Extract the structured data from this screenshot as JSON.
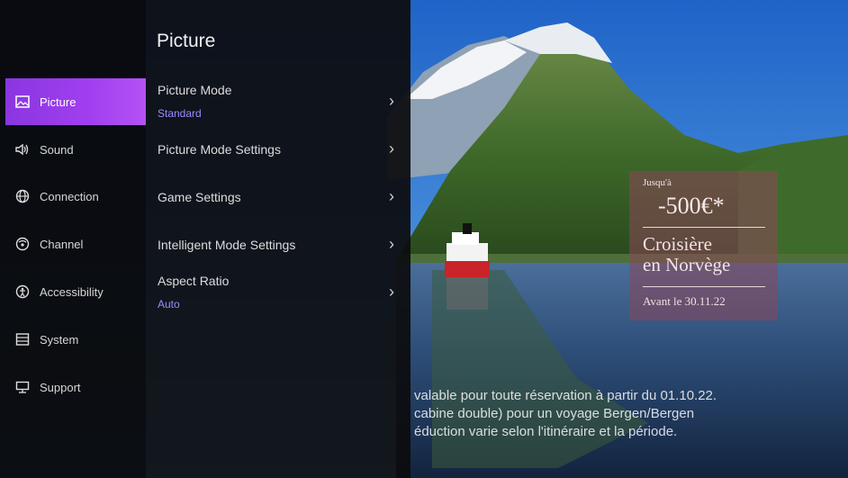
{
  "sidebar": {
    "items": [
      {
        "label": "Picture",
        "icon": "picture-icon",
        "active": true
      },
      {
        "label": "Sound",
        "icon": "speaker-icon",
        "active": false
      },
      {
        "label": "Connection",
        "icon": "globe-icon",
        "active": false
      },
      {
        "label": "Channel",
        "icon": "channel-icon",
        "active": false
      },
      {
        "label": "Accessibility",
        "icon": "accessibility-icon",
        "active": false
      },
      {
        "label": "System",
        "icon": "system-icon",
        "active": false
      },
      {
        "label": "Support",
        "icon": "support-icon",
        "active": false
      }
    ]
  },
  "panel": {
    "title": "Picture",
    "rows": [
      {
        "label": "Picture Mode",
        "value": "Standard"
      },
      {
        "label": "Picture Mode Settings"
      },
      {
        "label": "Game Settings"
      },
      {
        "label": "Intelligent Mode Settings"
      },
      {
        "label": "Aspect Ratio",
        "value": "Auto"
      }
    ],
    "chevron": "›"
  },
  "promo": {
    "upto": "Jusqu'à",
    "amount": "-500€*",
    "title_line1": "Croisière",
    "title_line2": "en Norvège",
    "deadline": "Avant le 30.11.22"
  },
  "legal": {
    "line1": "valable pour toute réservation à partir du 01.10.22.",
    "line2": "cabine double) pour un voyage Bergen/Bergen",
    "line3": "éduction varie selon l'itinéraire et la période."
  },
  "colors": {
    "accent": "#a13ff0",
    "value_text": "#9c8cff"
  }
}
